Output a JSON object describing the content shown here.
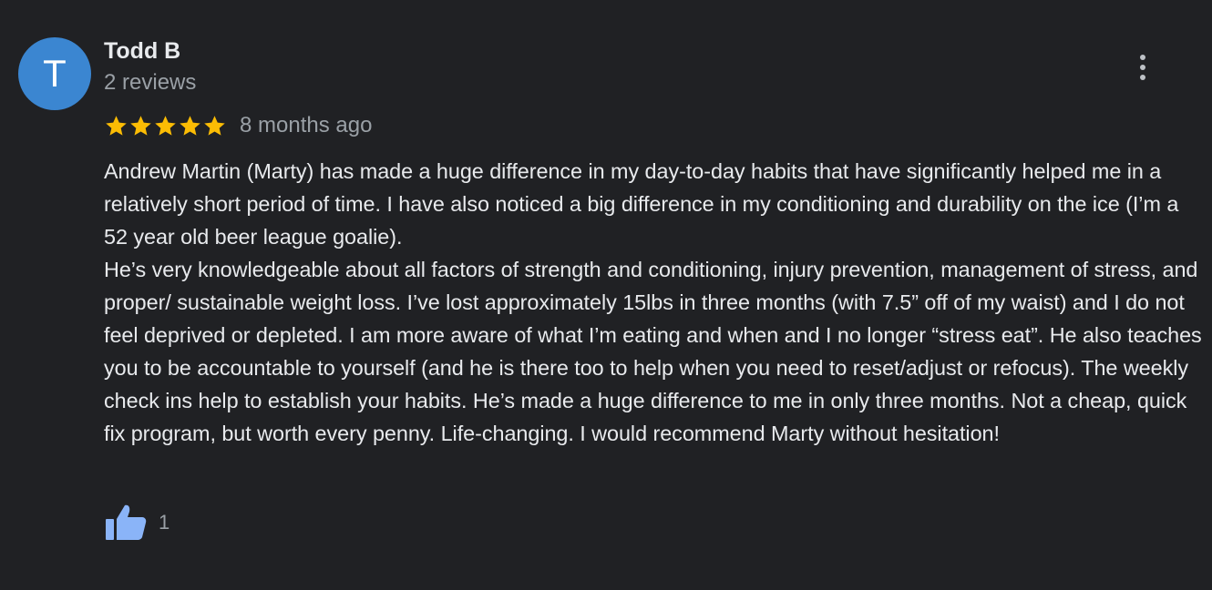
{
  "review": {
    "author": {
      "initial": "T",
      "name": "Todd B",
      "meta": "2 reviews",
      "avatar_color": "#3b86d1"
    },
    "rating": 5,
    "rating_max": 5,
    "star_color": "#fbbc04",
    "date": "8 months ago",
    "text": "Andrew Martin (Marty) has made a huge difference in my day-to-day habits that have significantly helped me in a relatively short period of time. I have also noticed a big difference in my conditioning and durability on the ice (I’m a 52 year old beer league goalie).\nHe’s very knowledgeable about all factors of strength and conditioning, injury prevention, management of stress, and proper/ sustainable weight loss. I’ve lost approximately 15lbs in three months (with 7.5” off of my waist) and I do not feel deprived or depleted. I am more aware of what I’m eating and when and I no longer “stress eat”. He also teaches you to be accountable to yourself (and he is there too to help when you need to reset/adjust or refocus). The weekly check ins help to establish your habits. He’s made a huge difference to me in only three months. Not a cheap, quick fix program, but worth every penny. Life-changing. I would recommend Marty without hesitation!",
    "likes": "1",
    "like_icon": "thumbs-up-icon",
    "like_color": "#8ab4f8",
    "menu_icon": "more-vert-icon"
  }
}
